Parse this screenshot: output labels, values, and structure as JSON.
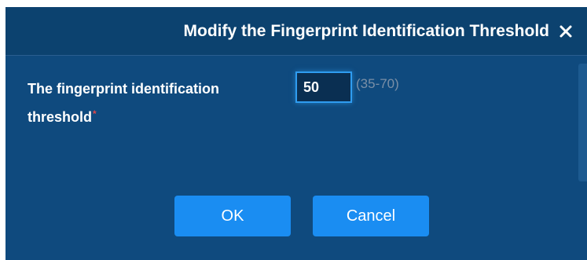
{
  "dialog": {
    "title": "Modify the Fingerprint Identification Threshold",
    "close_icon": "close-icon"
  },
  "form": {
    "label": "The fingerprint identification threshold",
    "required_mark": "*",
    "threshold_value": "50",
    "range_hint": "(35-70)"
  },
  "buttons": {
    "ok_label": "OK",
    "cancel_label": "Cancel"
  },
  "colors": {
    "dialog_bg": "#0f4a7e",
    "titlebar_bg": "#0c426f",
    "button_bg": "#1a8df2",
    "input_border": "#2f9cf0",
    "required_mark": "#e24848"
  }
}
